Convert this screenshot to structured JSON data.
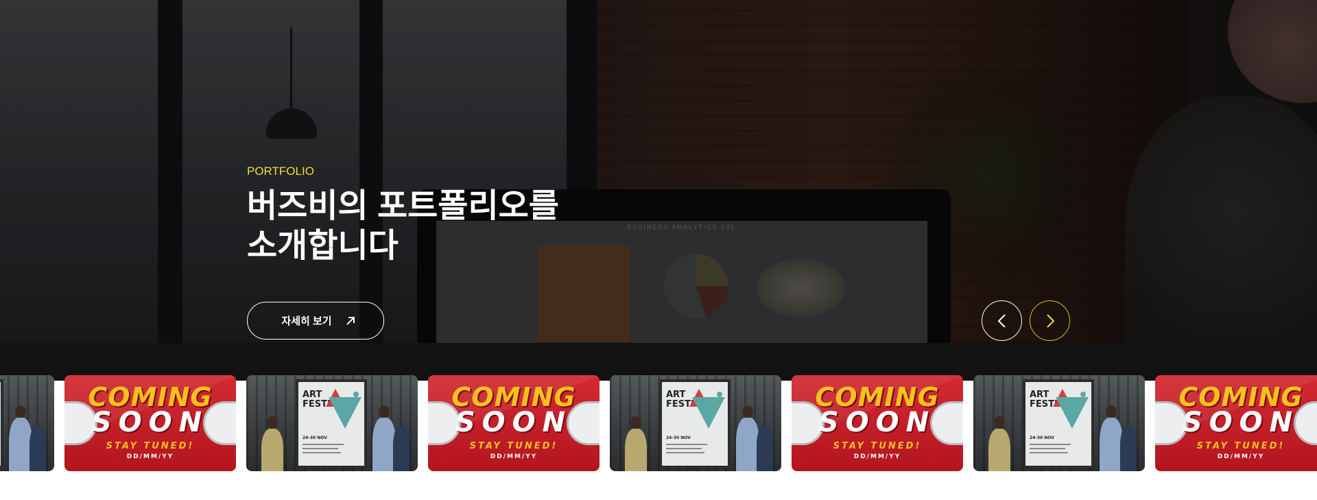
{
  "hero": {
    "eyebrow": "PORTFOLIO",
    "headline_line1": "버즈비의 포트폴리오를",
    "headline_line2": "소개합니다",
    "more_button_label": "자세히 보기",
    "background_screen_title": "BUSINESS ANALYTICS 101"
  },
  "navigation": {
    "prev_icon": "chevron-left-icon",
    "next_icon": "chevron-right-icon"
  },
  "colors": {
    "accent": "#f2dc3a",
    "next_button_border": "#d9bc2a",
    "strip": "#121212"
  },
  "carousel": {
    "cards": [
      {
        "type": "art-festival"
      },
      {
        "type": "coming-soon"
      },
      {
        "type": "art-festival"
      },
      {
        "type": "coming-soon"
      },
      {
        "type": "art-festival"
      },
      {
        "type": "coming-soon"
      },
      {
        "type": "art-festival"
      },
      {
        "type": "coming-soon"
      }
    ],
    "coming_soon": {
      "line1": "COMING",
      "line2": "SOON",
      "line3": "STAY TUNED!",
      "line4": "DD/MM/YY"
    },
    "art_festival": {
      "title_line1": "ART",
      "title_line2": "FESTIVAL",
      "dates": "24-30 NOV"
    }
  }
}
